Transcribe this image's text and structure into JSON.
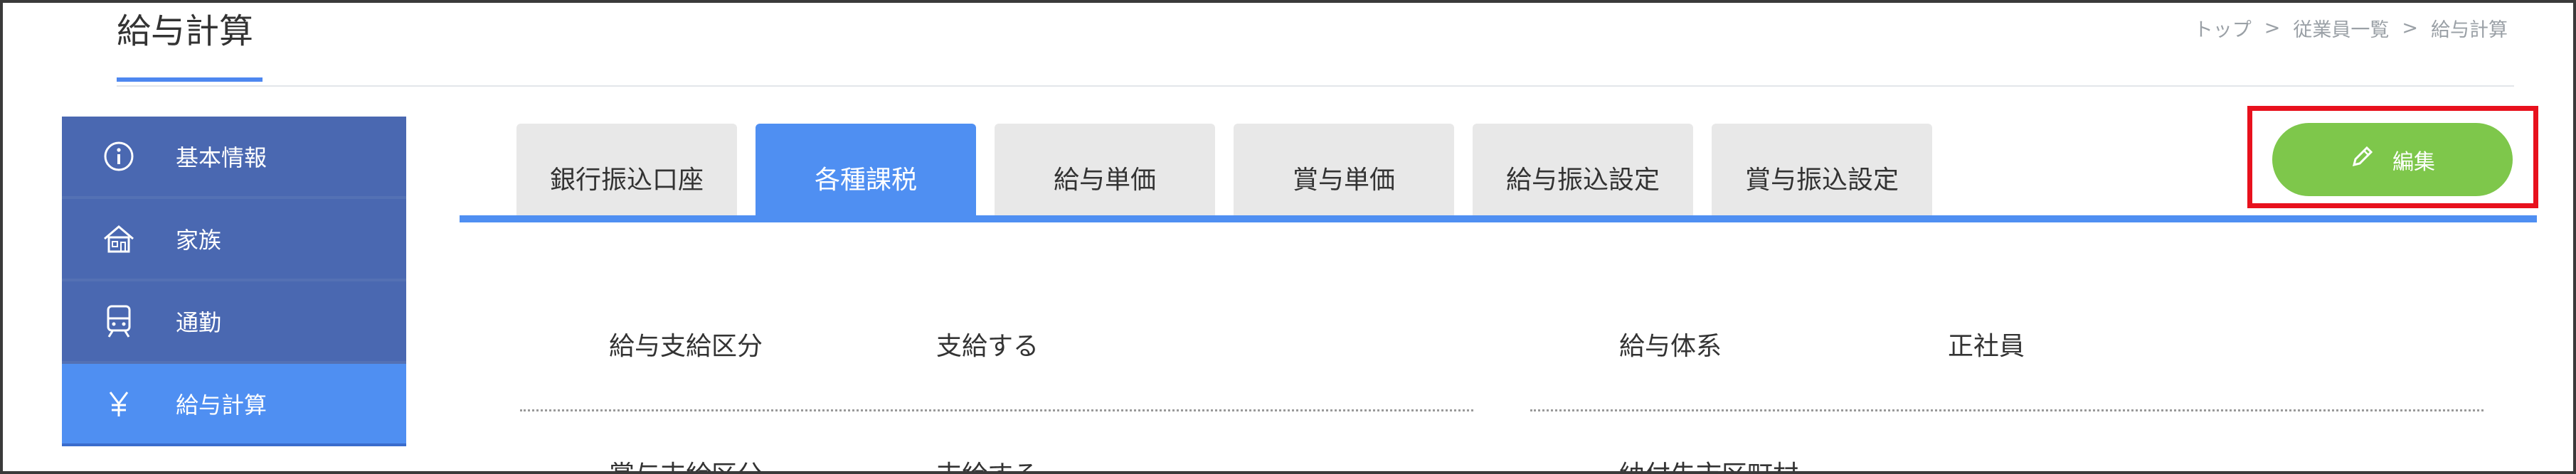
{
  "header": {
    "title": "給与計算",
    "breadcrumb": [
      "トップ",
      "従業員一覧",
      "給与計算"
    ],
    "breadcrumb_sep": ">"
  },
  "sidebar": {
    "items": [
      {
        "label": "基本情報",
        "icon": "info-icon",
        "active": false
      },
      {
        "label": "家族",
        "icon": "house-icon",
        "active": false
      },
      {
        "label": "通勤",
        "icon": "train-icon",
        "active": false
      },
      {
        "label": "給与計算",
        "icon": "yen-icon",
        "active": true
      }
    ]
  },
  "tabs": [
    {
      "label": "銀行振込口座",
      "active": false
    },
    {
      "label": "各種課税",
      "active": true
    },
    {
      "label": "給与単価",
      "active": false
    },
    {
      "label": "賞与単価",
      "active": false
    },
    {
      "label": "給与振込設定",
      "active": false
    },
    {
      "label": "賞与振込設定",
      "active": false
    }
  ],
  "edit_button": {
    "label": "編集",
    "icon": "pencil-icon"
  },
  "fields": {
    "left": [
      {
        "label": "給与支給区分",
        "value": "支給する"
      },
      {
        "label": "賞与支給区分",
        "value": "支給する"
      }
    ],
    "right": [
      {
        "label": "給与体系",
        "value": "正社員"
      },
      {
        "label": "納付先市区町村",
        "value": ""
      }
    ]
  },
  "colors": {
    "accent": "#4f8ff2",
    "sidebar_bg": "#4a68b1",
    "edit_button": "#7ec74b",
    "highlight_frame": "#e8111d"
  }
}
